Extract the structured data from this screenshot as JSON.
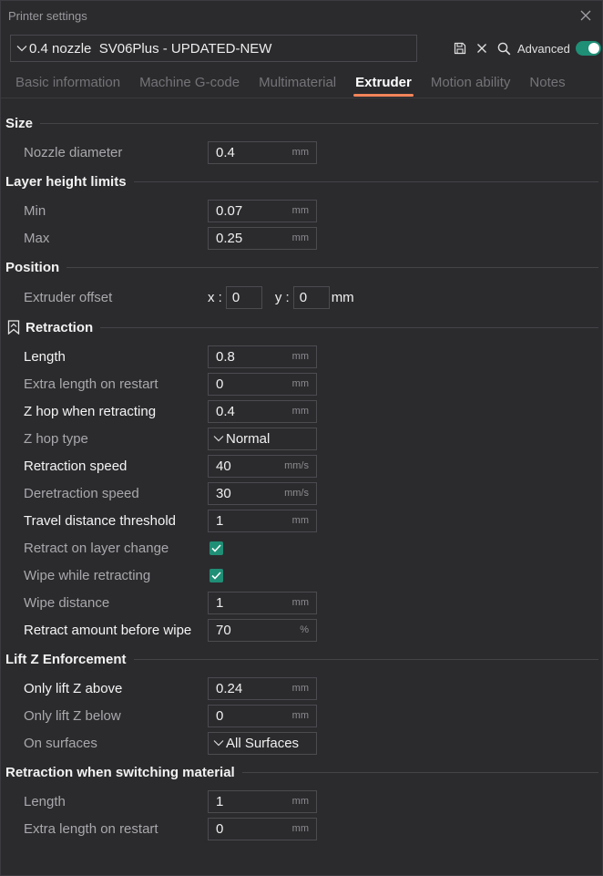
{
  "window": {
    "title": "Printer settings"
  },
  "preset": {
    "name": "0.4 nozzle  SV06Plus - UPDATED-NEW"
  },
  "toolbar": {
    "advanced_label": "Advanced",
    "advanced_on": true
  },
  "tabs": [
    {
      "label": "Basic information"
    },
    {
      "label": "Machine G-code"
    },
    {
      "label": "Multimaterial"
    },
    {
      "label": "Extruder"
    },
    {
      "label": "Motion ability"
    },
    {
      "label": "Notes"
    }
  ],
  "active_tab": "Extruder",
  "sections": {
    "size": {
      "title": "Size",
      "nozzle_diameter": {
        "label": "Nozzle diameter",
        "value": "0.4",
        "unit": "mm"
      }
    },
    "layer_height": {
      "title": "Layer height limits",
      "min": {
        "label": "Min",
        "value": "0.07",
        "unit": "mm"
      },
      "max": {
        "label": "Max",
        "value": "0.25",
        "unit": "mm"
      }
    },
    "position": {
      "title": "Position",
      "extruder_offset": {
        "label": "Extruder offset",
        "x_label": "x :",
        "x_value": "0",
        "y_label": "y :",
        "y_value": "0",
        "unit": "mm"
      }
    },
    "retraction": {
      "title": "Retraction",
      "length": {
        "label": "Length",
        "value": "0.8",
        "unit": "mm"
      },
      "extra_length": {
        "label": "Extra length on restart",
        "value": "0",
        "unit": "mm"
      },
      "z_hop": {
        "label": "Z hop when retracting",
        "value": "0.4",
        "unit": "mm"
      },
      "z_hop_type": {
        "label": "Z hop type",
        "value": "Normal"
      },
      "retraction_speed": {
        "label": "Retraction speed",
        "value": "40",
        "unit": "mm/s"
      },
      "deretraction_speed": {
        "label": "Deretraction speed",
        "value": "30",
        "unit": "mm/s"
      },
      "travel_threshold": {
        "label": "Travel distance threshold",
        "value": "1",
        "unit": "mm"
      },
      "retract_layer_change": {
        "label": "Retract on layer change",
        "checked": true
      },
      "wipe_while_retracting": {
        "label": "Wipe while retracting",
        "checked": true
      },
      "wipe_distance": {
        "label": "Wipe distance",
        "value": "1",
        "unit": "mm"
      },
      "retract_before_wipe": {
        "label": "Retract amount before wipe",
        "value": "70",
        "unit": "%"
      }
    },
    "lift_z": {
      "title": "Lift Z Enforcement",
      "above": {
        "label": "Only lift Z above",
        "value": "0.24",
        "unit": "mm"
      },
      "below": {
        "label": "Only lift Z below",
        "value": "0",
        "unit": "mm"
      },
      "surfaces": {
        "label": "On surfaces",
        "value": "All Surfaces"
      }
    },
    "switching": {
      "title": "Retraction when switching material",
      "length": {
        "label": "Length",
        "value": "1",
        "unit": "mm"
      },
      "extra_length": {
        "label": "Extra length on restart",
        "value": "0",
        "unit": "mm"
      }
    }
  },
  "colors": {
    "accent": "#1f8f76",
    "tab_underline": "#f2855a",
    "background": "#2b2b2e"
  }
}
